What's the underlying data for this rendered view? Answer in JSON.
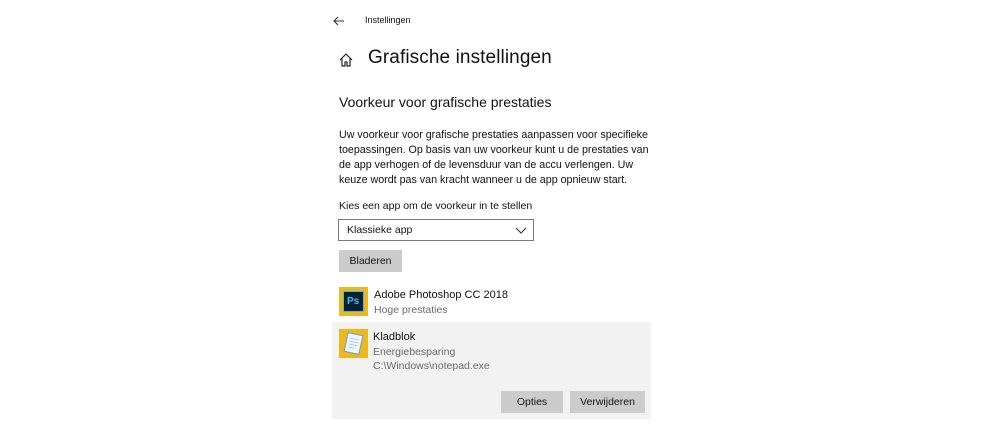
{
  "header": {
    "window_title": "Instellingen",
    "back_icon": "back-arrow-icon"
  },
  "page": {
    "title": "Grafische instellingen",
    "home_icon": "home-icon"
  },
  "section": {
    "title": "Voorkeur voor grafische prestaties",
    "description": "Uw voorkeur voor grafische prestaties aanpassen voor specifieke toepassingen. Op basis van uw voorkeur kunt u de prestaties van de app verhogen of de levensduur van de accu verlengen. Uw keuze wordt pas van kracht wanneer u de app opnieuw start."
  },
  "app_picker": {
    "label": "Kies een app om de voorkeur in te stellen",
    "selected": "Klassieke app",
    "browse_label": "Bladeren"
  },
  "apps": [
    {
      "name": "Adobe Photoshop CC 2018",
      "preference": "Hoge prestaties",
      "icon": "photoshop-icon",
      "icon_text": "Ps"
    },
    {
      "name": "Kladblok",
      "preference": "Energiebesparing",
      "path": "C:\\Windows\\notepad.exe",
      "icon": "notepad-icon"
    }
  ],
  "selected_app_actions": {
    "options_label": "Opties",
    "remove_label": "Verwijderen"
  },
  "colors": {
    "selected_bg": "#f2f2f2",
    "button_bg": "#cccccc",
    "icon_bg": "#f0b61e",
    "photoshop_dark": "#0b1f2f",
    "photoshop_blue": "#31c5f0"
  }
}
